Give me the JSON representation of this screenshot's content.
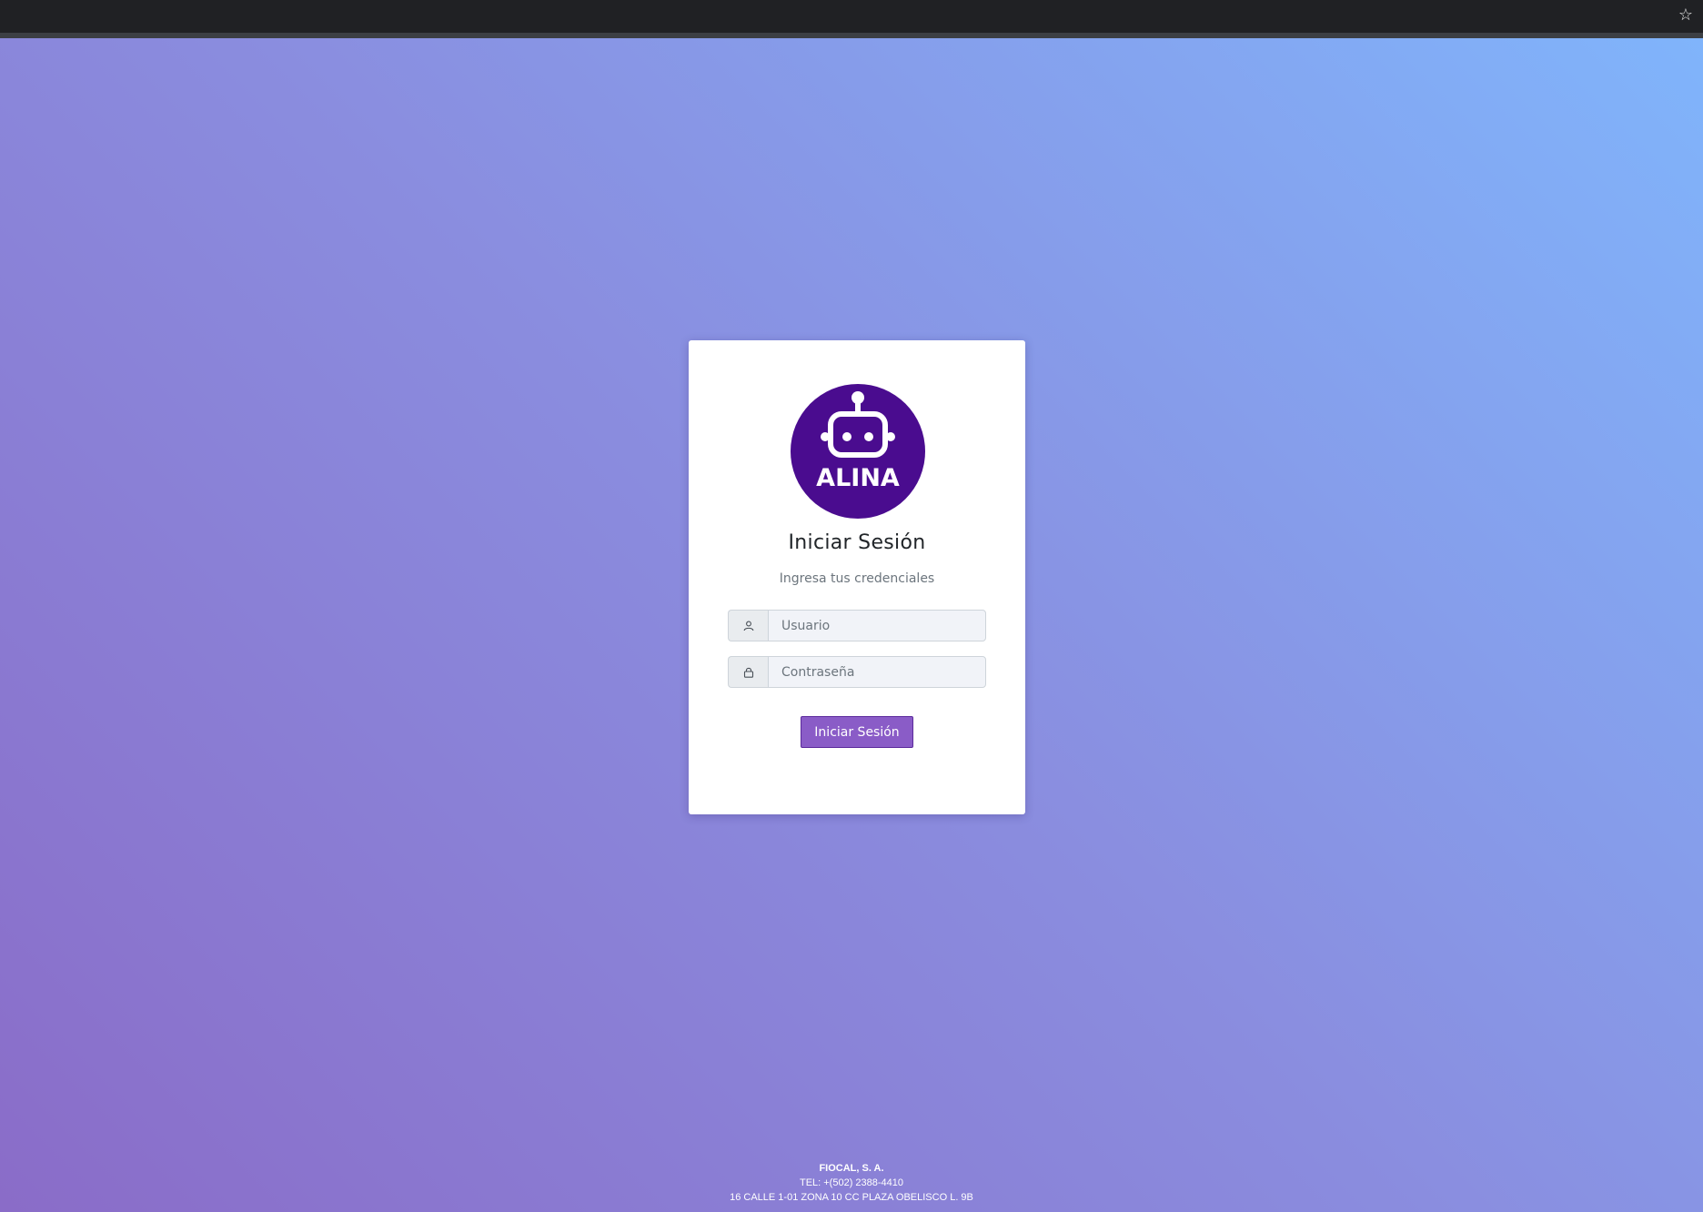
{
  "browser": {
    "bookmark_icon": "star-outline-icon"
  },
  "login": {
    "logo_text": "ALINA",
    "logo_color": "#4a0c8f",
    "title": "Iniciar Sesión",
    "subtitle": "Ingresa tus credenciales",
    "username": {
      "icon": "user-icon",
      "placeholder": "Usuario",
      "value": ""
    },
    "password": {
      "icon": "lock-icon",
      "placeholder": "Contraseña",
      "value": ""
    },
    "submit_label": "Iniciar Sesión",
    "button_color": "#8a5cc7"
  },
  "footer": {
    "company": "FIOCAL, S. A.",
    "phone": "TEL: +(502) 2388-4410",
    "address": "16 CALLE 1-01 ZONA 10 CC PLAZA OBELISCO L. 9B"
  }
}
